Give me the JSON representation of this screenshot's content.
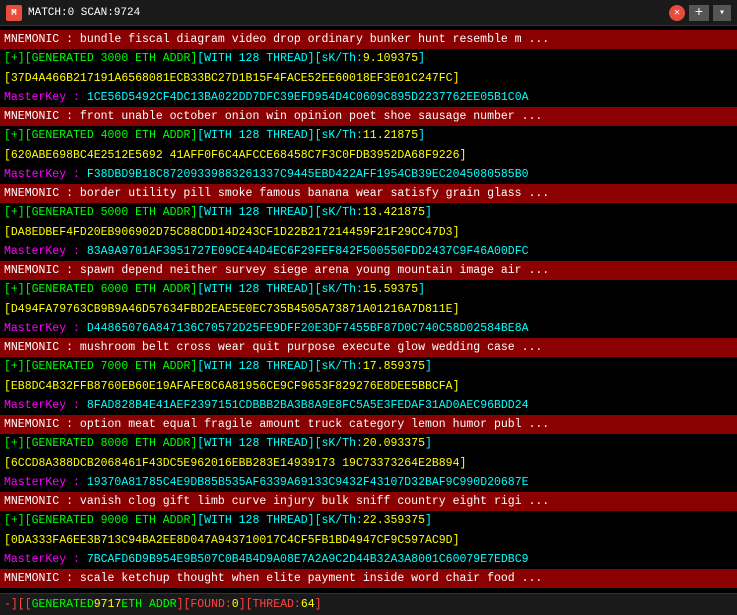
{
  "titlebar": {
    "icon_label": "M",
    "title": "MATCH:0 SCAN:9724",
    "close_btn": "✕",
    "plus_btn": "+",
    "drop_btn": "▾"
  },
  "blocks": [
    {
      "mnemonic": "MNEMONIC : bundle fiscal diagram video drop ordinary bunker hunt resemble m ...",
      "generated": "[+][GENERATED 3000 ETH ADDR][WITH 128 THREAD][sK/Th:9.109375]",
      "hex": "[37D4A466B217191A6568081ECB33BC27D1B15F4FACE52EE60018EF3E01C247FC]",
      "masterkey": "MasterKey :  1CE56D5492CF4DC13BA022DD7DFC39EFD954D4C0609C895D2237762EE05B1C0A"
    },
    {
      "mnemonic": "MNEMONIC : front unable october onion win opinion poet shoe sausage number ...",
      "generated": "[+][GENERATED 4000 ETH ADDR][WITH 128 THREAD][sK/Th:11.21875]",
      "hex": "[620ABE698BC4E2512E5692 41AFF0F6C4AFCCE68458C7F3C0FDB3952DA68F9226]",
      "masterkey": "MasterKey :  F38DBD9B18C87209339883261337C9445EBD422AFF1954CB39EC2045080585B0"
    },
    {
      "mnemonic": "MNEMONIC : border utility pill smoke famous banana wear satisfy grain glass ...",
      "generated": "[+][GENERATED 5000 ETH ADDR][WITH 128 THREAD][sK/Th:13.421875]",
      "hex": "[DA8EDBEF4FD20EB906902D75C88CDD14D243CF1D22B217214459F21F29CC47D3]",
      "masterkey": "MasterKey :  83A9A9701AF3951727E09CE44D4EC6F29FEF842F500550FDD2437C9F46A00DFC"
    },
    {
      "mnemonic": "MNEMONIC : spawn depend neither survey siege arena young mountain image air ...",
      "generated": "[+][GENERATED 6000 ETH ADDR][WITH 128 THREAD][sK/Th:15.59375]",
      "hex": "[D494FA79763CB9B9A46D57634FBD2EAE5E0EC735B4505A73871A01216A7D811E]",
      "masterkey": "MasterKey :  D44865076A847136C70572D25FE9DFF20E3DF7455BF87D0C740C58D02584BE8A"
    },
    {
      "mnemonic": "MNEMONIC : mushroom belt cross wear quit purpose execute glow wedding case ...",
      "generated": "[+][GENERATED 7000 ETH ADDR][WITH 128 THREAD][sK/Th:17.859375]",
      "hex": "[EB8DC4B32FFB8760EB60E19AFAFE8C6A81956CE9CF9653F829276E8DEE5BBCFA]",
      "masterkey": "MasterKey :  8FAD828B4E41AEF2397151CDBBB2BA3B8A9E8FC5A5E3FEDAF31AD0AEC96BDD24"
    },
    {
      "mnemonic": "MNEMONIC : option meat equal fragile amount truck category lemon humor publ ...",
      "generated": "[+][GENERATED 8000 ETH ADDR][WITH 128 THREAD][sK/Th:20.093375]",
      "hex": "[6CCD8A388DCB2068461F43DC5E962016EBB283E14939173 19C73373264E2B894]",
      "masterkey": "MasterKey :  19370A81785C4E9DB85B535AF6339A69133C9432F43107D32BAF9C990D20687E"
    },
    {
      "mnemonic": "MNEMONIC : vanish clog gift limb curve injury bulk sniff country eight rigi ...",
      "generated": "[+][GENERATED 9000 ETH ADDR][WITH 128 THREAD][sK/Th:22.359375]",
      "hex": "[0DA333FA6EE3B713C94BA2EE8D047A943710017C4CF5FB1BD4947CF9C597AC9D]",
      "masterkey": "MasterKey :  7BCAFD6D9B954E9B507C0B4B4D9A08E7A2A9C2D44B32A3A8001C60079E7EDBC9"
    },
    {
      "mnemonic": "MNEMONIC : scale ketchup thought when elite payment inside word chair food ...",
      "generated": "",
      "hex": "",
      "masterkey": ""
    }
  ],
  "statusbar": {
    "label1": "-][",
    "generated_label": " GENERATED ",
    "scan_num": "9717",
    "eth_label": " ETH ADDR ",
    "found_label": "][FOUND:",
    "found_val": "0",
    "thread_label": "][THREAD:",
    "thread_val": "64",
    "close_bracket": "]"
  }
}
